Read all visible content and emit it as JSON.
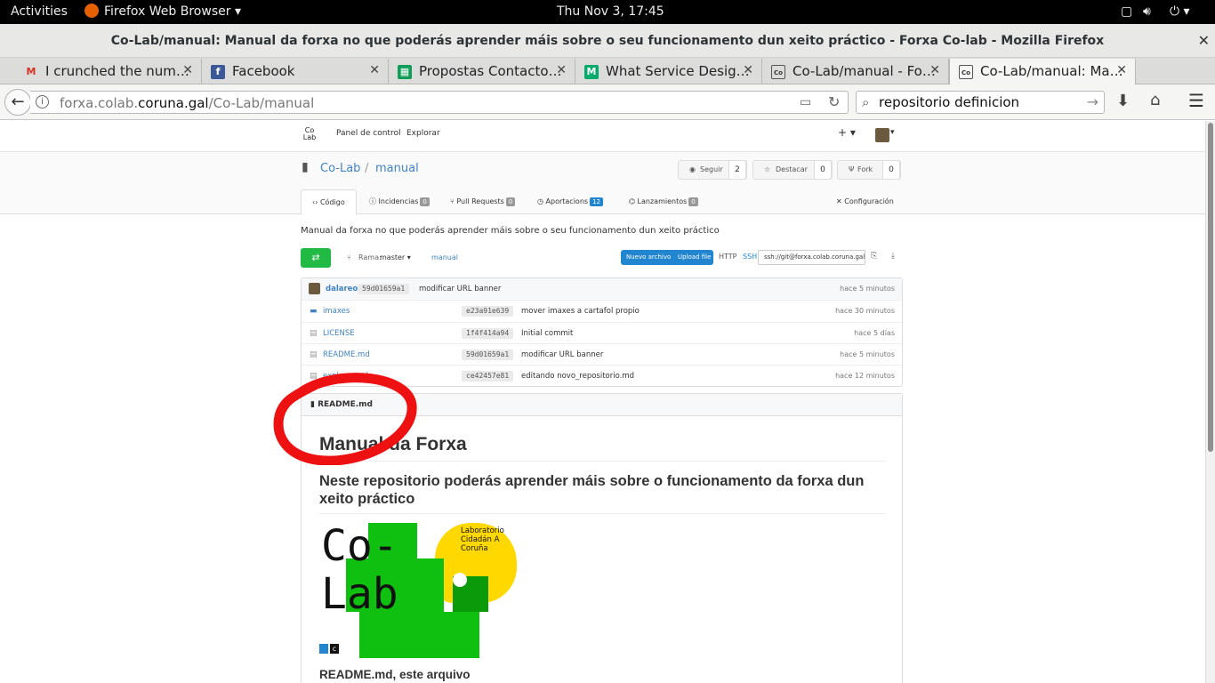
{
  "system_bar": {
    "activities": "Activities",
    "app_menu": "Firefox Web Browser ▾",
    "clock": "Thu Nov  3, 17:45"
  },
  "window": {
    "title": "Co-Lab/manual: Manual da forxa no que poderás aprender máis sobre o seu funcionamento dun xeito práctico - Forxa Co-lab - Mozilla Firefox"
  },
  "tabs": [
    {
      "label": "I crunched the num…",
      "favicon": "gmail-icon",
      "color": "#d93025"
    },
    {
      "label": "Facebook",
      "favicon": "facebook-icon",
      "color": "#3b5998"
    },
    {
      "label": "Propostas Contacto…",
      "favicon": "sheets-icon",
      "color": "#0f9d58"
    },
    {
      "label": "What Service Desig…",
      "favicon": "medium-icon",
      "color": "#00ab6c"
    },
    {
      "label": "Co-Lab/manual - Fo…",
      "favicon": "colab-icon",
      "color": "#333333"
    },
    {
      "label": "Co-Lab/manual: Ma…",
      "favicon": "colab-icon",
      "color": "#333333"
    }
  ],
  "navbar": {
    "url_domain_prefix": "forxa.colab.",
    "url_domain_main": "coruna.gal",
    "url_path": "/Co-Lab/manual",
    "search_value": "repositorio definicion"
  },
  "site_nav": {
    "logo": "Co Lab",
    "control_panel": "Panel de control",
    "explore": "Explorar",
    "plus": "+ ▾"
  },
  "repo": {
    "owner": "Co-Lab",
    "separator": "/",
    "name": "manual",
    "watch_label": "Seguir",
    "watch_count": "2",
    "star_label": "Destacar",
    "star_count": "0",
    "fork_label": "Fork",
    "fork_count": "0",
    "description": "Manual da forxa no que poderás aprender máis sobre o seu funcionamento dun xeito práctico"
  },
  "repo_tabs": {
    "code": "Código",
    "issues": "Incidencias",
    "issues_count": "0",
    "pulls": "Pull Requests",
    "pulls_count": "0",
    "commits": "Aportacions",
    "commits_count": "12",
    "releases": "Lanzamientos",
    "releases_count": "0",
    "settings": "Configuración"
  },
  "toolbar": {
    "branch_label": "Rama:",
    "branch_value": "master ▾",
    "path": "manual",
    "new_file": "Nuevo archivo",
    "upload_file": "Upload file",
    "http": "HTTP",
    "ssh": "SSH",
    "clone_url": "ssh://git@forxa.colab.coruna.gal"
  },
  "last_commit": {
    "author": "dalareo",
    "sha": "59d01659a1",
    "message": "modificar URL banner",
    "age": "hace 5 minutos"
  },
  "files": [
    {
      "name": "imaxes",
      "type": "folder",
      "sha": "e23a91e639",
      "message": "mover imaxes a cartafol propio",
      "age": "hace 30 minutos"
    },
    {
      "name": "LICENSE",
      "type": "file",
      "sha": "1f4f414a94",
      "message": "Initial commit",
      "age": "hace 5 días"
    },
    {
      "name": "README.md",
      "type": "file",
      "sha": "59d01659a1",
      "message": "modificar URL banner",
      "age": "hace 5 minutos"
    },
    {
      "name": "explorar.md",
      "type": "file",
      "sha": "ce42457e81",
      "message": "editando novo_repositorio.md",
      "age": "hace 12 minutos"
    }
  ],
  "readme": {
    "filename": "README.md",
    "h1": "Manual da Forxa",
    "h2": "Neste repositorio poderás aprender máis sobre o funcionamento da forxa dun xeito práctico",
    "logo_text_1": "Co-",
    "logo_text_2": "Lab",
    "logo_caption": "Laboratorio Cidadán A Coruña",
    "h3": "README.md, este arquivo"
  },
  "colors": {
    "green": "#21ba45",
    "blue": "#2185d0",
    "link": "#4183c4",
    "annotation_red": "#ee1111",
    "logo_green": "#10c010",
    "logo_yellow": "#ffd800"
  }
}
